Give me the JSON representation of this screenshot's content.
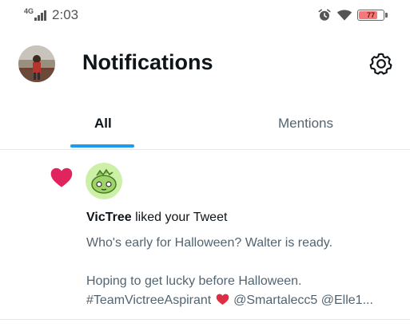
{
  "status_bar": {
    "network": "4G",
    "time": "2:03",
    "battery_level": "77",
    "battery_fraction": 0.77,
    "icons": [
      "signal-icon",
      "alarm-icon",
      "wifi-icon",
      "battery-icon"
    ]
  },
  "header": {
    "title": "Notifications",
    "icons": [
      "profile-avatar",
      "gear-icon"
    ]
  },
  "tabs": [
    {
      "label": "All",
      "active": true
    },
    {
      "label": "Mentions",
      "active": false
    }
  ],
  "notifications": [
    {
      "type": "like",
      "icon": "heart-icon",
      "actor": "VicTree",
      "action": " liked your Tweet",
      "tweet_line1": "Who's early for Halloween? Walter is ready.",
      "tweet_line2": "Hoping to get lucky before Halloween.",
      "tweet_line3_a": "#TeamVictreeAspirant",
      "tweet_line3_b": "@Smartalecc5 @Elle1..."
    }
  ],
  "colors": {
    "accent": "#1d9bf0",
    "like_red": "#f91880",
    "heart_red": "#e0245e",
    "text_primary": "#0f1419",
    "text_secondary": "#536471"
  }
}
